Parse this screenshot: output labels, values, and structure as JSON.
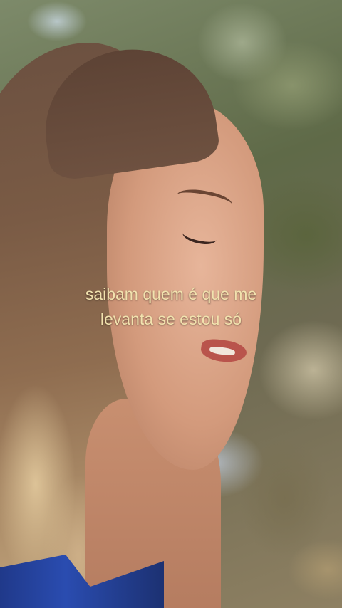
{
  "video": {
    "subtitle_lines": [
      "saibam quem é que me",
      "levanta se estou só"
    ],
    "subtitle_color": "#f2e2ae"
  }
}
